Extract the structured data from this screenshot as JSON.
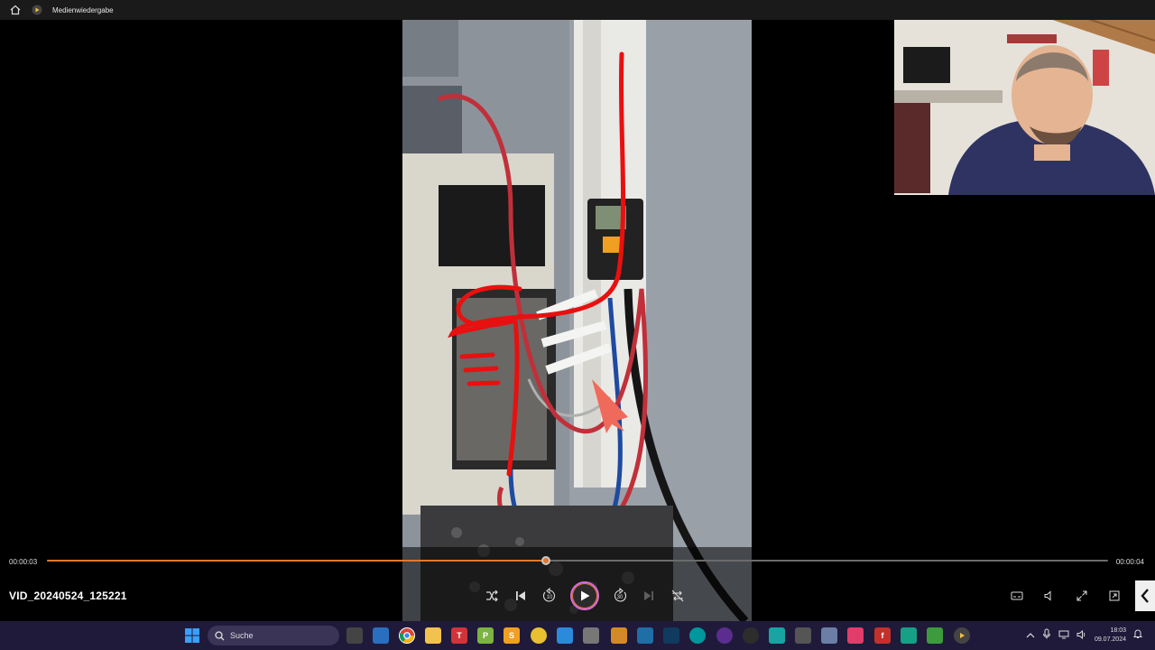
{
  "window": {
    "title": "Medienwiedergabe",
    "home_icon": "home-icon",
    "app_icon": "media-player-icon"
  },
  "player": {
    "current_time": "00:00:03",
    "duration": "00:00:04",
    "progress": 0.47,
    "filename": "VID_20240524_125221",
    "accent_color": "#e0782e"
  },
  "controls": {
    "shuffle_icon": "shuffle-icon",
    "previous_icon": "previous-icon",
    "skip_back_label": "10",
    "play_icon": "play-icon",
    "skip_forward_label": "30",
    "next_icon": "next-icon",
    "repeat_icon": "repeat-off-icon",
    "right": [
      "subtitles-icon",
      "volume-icon",
      "fullscreen-icon",
      "miniplayer-icon"
    ]
  },
  "taskbar": {
    "search_placeholder": "Suche",
    "time": "18:03",
    "date": "09.07.2024",
    "app_letters": {
      "t": "T",
      "p": "P",
      "s": "S",
      "f": "f"
    }
  }
}
